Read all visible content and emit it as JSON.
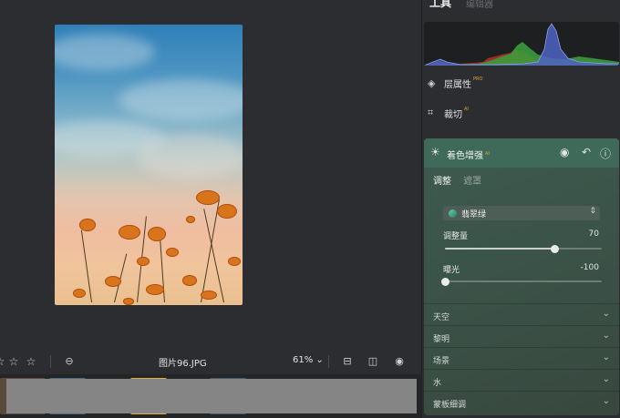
{
  "canvas": {
    "filename": "图片96.JPG",
    "zoom": "61%"
  },
  "panel": {
    "title": "工具",
    "subtitle": "编辑器",
    "items": [
      {
        "label": "层属性",
        "badge": "PRO"
      },
      {
        "label": "裁切",
        "badge": "AI"
      }
    ]
  },
  "enhance": {
    "title": "着色增强",
    "badge": "AI",
    "tabs": [
      "调整",
      "遮罩"
    ],
    "preset": "翡翠绿",
    "sliders": [
      {
        "label": "调整量",
        "value": "70",
        "fraction": 0.7
      },
      {
        "label": "曝光",
        "value": "-100",
        "fraction": 0.0
      }
    ],
    "sections": [
      "天空",
      "黎明",
      "场景",
      "水",
      "蒙板细调"
    ]
  },
  "colors": {
    "accent": "#3f6a5a",
    "badge": "#e3a23c"
  }
}
